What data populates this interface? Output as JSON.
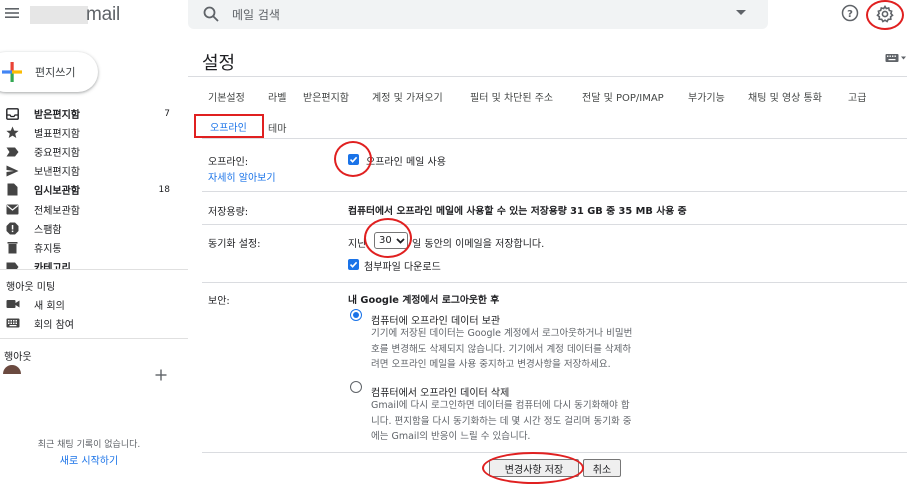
{
  "app": {
    "logo_text": "mail",
    "search_placeholder": "메일 검색"
  },
  "icons": {
    "menu": "hamburger-menu-icon",
    "search": "search-icon",
    "search_options": "caret-down-icon",
    "help": "help-circle-icon",
    "settings": "gear-icon",
    "keyboard": "keyboard-icon"
  },
  "colors": {
    "accent": "#1a73e8",
    "annotation": "#e02020"
  },
  "sidebar": {
    "compose_label": "편지쓰기",
    "items": [
      {
        "label": "받은편지함",
        "count": "7",
        "icon": "inbox-icon",
        "bold": true
      },
      {
        "label": "별표편지함",
        "count": "",
        "icon": "star-icon",
        "bold": false
      },
      {
        "label": "중요편지함",
        "count": "",
        "icon": "important-icon",
        "bold": false
      },
      {
        "label": "보낸편지함",
        "count": "",
        "icon": "send-icon",
        "bold": false
      },
      {
        "label": "임시보관함",
        "count": "18",
        "icon": "draft-icon",
        "bold": true
      },
      {
        "label": "전체보관함",
        "count": "",
        "icon": "all-mail-icon",
        "bold": false
      },
      {
        "label": "스팸함",
        "count": "",
        "icon": "spam-icon",
        "bold": false
      },
      {
        "label": "휴지통",
        "count": "",
        "icon": "trash-icon",
        "bold": false
      },
      {
        "label": "카테고리",
        "count": "",
        "icon": "label-icon",
        "bold": true
      }
    ],
    "meet": {
      "title": "행아웃 미팅",
      "new_meeting": "새 회의",
      "join_meeting": "회의 참여"
    },
    "hangouts": {
      "title": "행아웃",
      "empty_text": "최근 채팅 기록이 없습니다.",
      "start_link": "새로 시작하기"
    }
  },
  "settings": {
    "title": "설정",
    "tabs": [
      "기본설정",
      "라벨",
      "받은편지함",
      "계정 및 가져오기",
      "필터 및 차단된 주소",
      "전달 및 POP/IMAP",
      "부가기능",
      "채팅 및 영상 통화",
      "고급"
    ],
    "tabs_row2": [
      "오프라인",
      "테마"
    ],
    "active_tab": "오프라인",
    "offline": {
      "label": "오프라인:",
      "learn_more": "자세히 알아보기",
      "enable_label": "오프라인 메일 사용",
      "enabled": true
    },
    "storage": {
      "label": "저장용량:",
      "value": "컴퓨터에서 오프라인 메일에 사용할 수 있는 저장용량 31 GB 중 35 MB 사용 중"
    },
    "sync": {
      "label": "동기화 설정:",
      "prefix": "지난",
      "days": "30",
      "suffix": "일 동안의 이메일을 저장합니다.",
      "attachments_label": "첨부파일 다운로드",
      "attachments": true
    },
    "security": {
      "label": "보안:",
      "heading": "내 Google 계정에서 로그아웃한 후",
      "keep_title": "컴퓨터에 오프라인 데이터 보관",
      "keep_desc": [
        "기기에 저장된 데이터는 Google 계정에서 로그아웃하거나 비밀번",
        "호를 변경해도 삭제되지 않습니다. 기기에서 계정 데이터를 삭제하",
        "려면 오프라인 메일을 사용 중지하고 변경사항을 저장하세요."
      ],
      "delete_title": "컴퓨터에서 오프라인 데이터 삭제",
      "delete_desc": [
        "Gmail에 다시 로그인하면 데이터를 컴퓨터에 다시 동기화해야 합",
        "니다. 편지함을 다시 동기화하는 데 몇 시간 정도 걸리며 동기화 중",
        "에는 Gmail의 반응이 느릴 수 있습니다."
      ],
      "selected": "keep"
    },
    "save_label": "변경사항 저장",
    "cancel_label": "취소"
  }
}
